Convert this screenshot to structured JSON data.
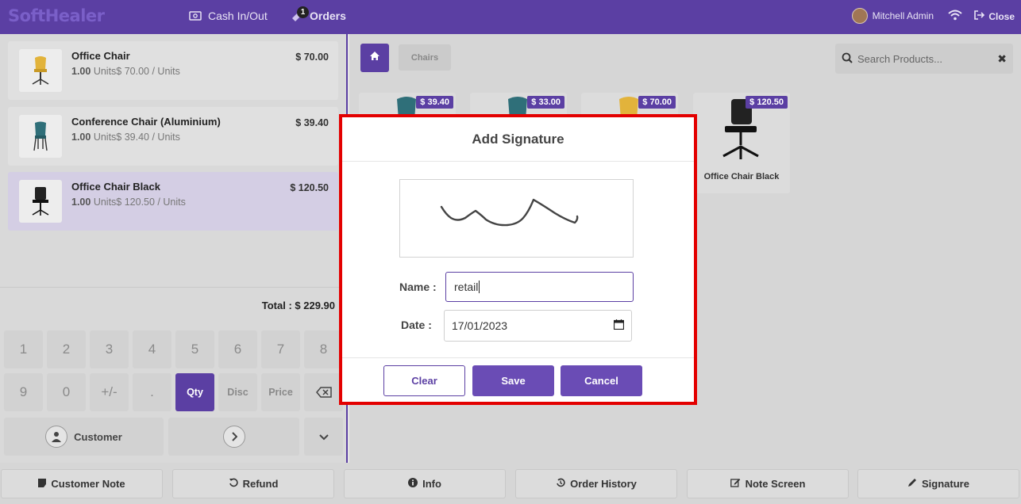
{
  "topbar": {
    "logo": "SoftHealer",
    "cash_label": "Cash In/Out",
    "orders_label": "Orders",
    "orders_badge": "1",
    "user_name": "Mitchell Admin",
    "close_label": "Close"
  },
  "order_lines": [
    {
      "name": "Office Chair",
      "qty": "1.00",
      "unit_info": "Units$ 70.00 / Units",
      "price": "$ 70.00"
    },
    {
      "name": "Conference Chair (Aluminium)",
      "qty": "1.00",
      "unit_info": "Units$ 39.40 / Units",
      "price": "$ 39.40"
    },
    {
      "name": "Office Chair Black",
      "qty": "1.00",
      "unit_info": "Units$ 120.50 / Units",
      "price": "$ 120.50"
    }
  ],
  "total": "Total : $ 229.90",
  "numpad": {
    "row1": [
      "1",
      "2",
      "3",
      "4",
      "5",
      "6",
      "7",
      "8"
    ],
    "row2": [
      "9",
      "0",
      "+/-",
      ".",
      "Qty",
      "Disc",
      "Price"
    ],
    "customer_label": "Customer"
  },
  "products": {
    "breadcrumb": "Chairs",
    "search_placeholder": "Search Products...",
    "items": [
      {
        "price": "$ 39.40",
        "name": ""
      },
      {
        "price": "$ 33.00",
        "name": ""
      },
      {
        "price": "$ 70.00",
        "name": ""
      },
      {
        "price": "$ 120.50",
        "name": "Office Chair Black"
      }
    ]
  },
  "bottom_bar": [
    "Customer Note",
    "Refund",
    "Info",
    "Order History",
    "Note Screen",
    "Signature"
  ],
  "modal": {
    "title": "Add Signature",
    "name_label": "Name :",
    "name_value": "retail",
    "date_label": "Date :",
    "date_value": "17/01/2023",
    "clear_label": "Clear",
    "save_label": "Save",
    "cancel_label": "Cancel"
  },
  "colors": {
    "brand": "#5b3fa3",
    "highlight_border": "#e30000"
  }
}
